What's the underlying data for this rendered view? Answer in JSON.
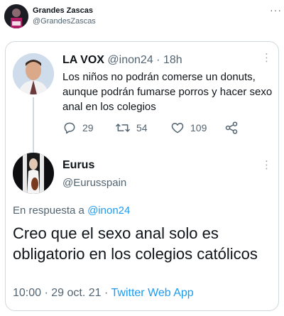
{
  "outer": {
    "name": "Grandes Zascas",
    "handle": "@GrandesZascas",
    "more": "···"
  },
  "tweet1": {
    "name": "LA VOX",
    "handle": "@inon24",
    "separator": "·",
    "time": "18h",
    "more": "⋮",
    "text": "Los niños no podrán comerse un donuts, aunque podrán fumarse porros y hacer sexo anal en los colegios",
    "replies": "29",
    "retweets": "54",
    "likes": "109"
  },
  "tweet2": {
    "name": "Eurus",
    "handle": "@Eurusspain",
    "more": "⋮",
    "reply_prefix": "En respuesta a ",
    "reply_handle": "@inon24",
    "text": "Creo que el sexo anal solo es obligatorio en los colegios católicos",
    "time": "10:00",
    "separator": "·",
    "date": "29 oct. 21",
    "separator2": "·",
    "source": "Twitter Web App"
  },
  "colors": {
    "accent": "#1d9bf0",
    "muted": "#536471",
    "border": "#cfd9de"
  },
  "icons": [
    "reply-icon",
    "retweet-icon",
    "like-icon",
    "share-icon",
    "more-icon"
  ]
}
